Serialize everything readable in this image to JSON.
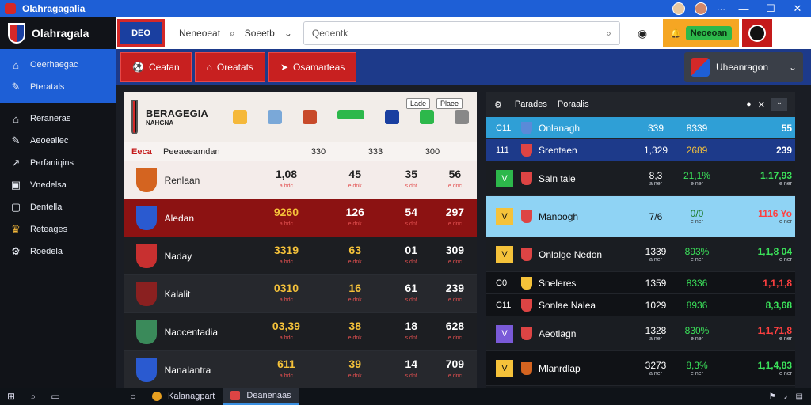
{
  "window": {
    "title": "Olahragagalia",
    "minimize": "—",
    "maximize": "☐",
    "close": "✕"
  },
  "topbar": {
    "brand": "DEO",
    "field_a": "Neneoeat",
    "field_b": "Soeetb",
    "search_placeholder": "Qeoentk",
    "notify_label": "Neoeoan"
  },
  "sidebar": {
    "logo": "Olahragala",
    "top_items": [
      {
        "label": "Oeerhaegac",
        "icon": "home-icon"
      },
      {
        "label": "Pteratals",
        "icon": "tools-icon"
      }
    ],
    "items": [
      {
        "label": "Reraneras",
        "icon": "home-icon"
      },
      {
        "label": "Aeoeallec",
        "icon": "edit-icon"
      },
      {
        "label": "Perfaniqins",
        "icon": "chart-icon"
      },
      {
        "label": "Vnedelsa",
        "icon": "media-icon"
      },
      {
        "label": "Dentella",
        "icon": "calendar-icon"
      },
      {
        "label": "Reteages",
        "icon": "trophy-icon"
      },
      {
        "label": "Roedela",
        "icon": "settings-icon"
      }
    ]
  },
  "subheader": {
    "tabs": [
      {
        "label": "Ceatan",
        "icon": "ball-icon"
      },
      {
        "label": "Oreatats",
        "icon": "home-icon"
      },
      {
        "label": "Osamarteas",
        "icon": "arrow-icon"
      }
    ],
    "league": "Uheanragon"
  },
  "left_panel": {
    "club": "BERAGEGIA",
    "club_sub": "NAHGNA",
    "filter_a": "Lade",
    "filter_b": "Plaee",
    "col_head": {
      "code": "Eeca",
      "name": "Peeaeeamdan",
      "c1": "330",
      "c2": "333",
      "c3": "300"
    },
    "rows": [
      {
        "name": "Renlaan",
        "v1": "1,08",
        "s1": "a hdc",
        "v2": "45",
        "s2": "e dnk",
        "v3": "35",
        "s3": "s dnf",
        "v4": "56",
        "s4": "e dnc"
      },
      {
        "name": "Aledan",
        "v1": "9260",
        "s1": "a hdc",
        "v2": "126",
        "s2": "e dnk",
        "v3": "54",
        "s3": "s dnf",
        "v4": "297",
        "s4": "e dnc"
      },
      {
        "name": "Naday",
        "v1": "3319",
        "s1": "a hdc",
        "v2": "63",
        "s2": "e dnk",
        "v3": "01",
        "s3": "s dnf",
        "v4": "309",
        "s4": "e dnc"
      },
      {
        "name": "Kalalit",
        "v1": "0310",
        "s1": "a hdc",
        "v2": "16",
        "s2": "e dnk",
        "v3": "61",
        "s3": "s dnf",
        "v4": "239",
        "s4": "e dnc"
      },
      {
        "name": "Naocentadia",
        "v1": "03,39",
        "s1": "a hdc",
        "v2": "38",
        "s2": "e dnk",
        "v3": "18",
        "s3": "s dnf",
        "v4": "628",
        "s4": "e dnc"
      },
      {
        "name": "Nanalantra",
        "v1": "611",
        "s1": "a hdc",
        "v2": "39",
        "s2": "e dnk",
        "v3": "14",
        "s3": "s dnf",
        "v4": "709",
        "s4": "e dnc"
      }
    ]
  },
  "right_panel": {
    "head_a": "Parades",
    "head_b": "Poraalis",
    "rows": [
      {
        "pos": "C11",
        "name": "Onlanagh",
        "v1": "339",
        "v2": "8339",
        "v3": "55"
      },
      {
        "pos": "111",
        "name": "Srentaen",
        "v1": "1,329",
        "v2": "2689",
        "v3": "239"
      },
      {
        "pos": "V",
        "name": "Saln tale",
        "v1": "8,3",
        "v1s": "a ner",
        "v2": "21,1%",
        "v2s": "e ner",
        "v3": "1,17,93",
        "v3s": "e ner"
      },
      {
        "pos": "V",
        "name": "Manoogh",
        "v1": "7/6",
        "v2": "0/0",
        "v2s": "e ner",
        "v3": "1116 Yo",
        "v3s": "e ner"
      },
      {
        "pos": "V",
        "name": "Onlalge Nedon",
        "v1": "1339",
        "v1s": "a ner",
        "v2": "893%",
        "v2s": "e ner",
        "v3": "1,1,8 04",
        "v3s": "e ner"
      },
      {
        "pos": "C0",
        "name": "Sneleres",
        "v1": "1359",
        "v2": "8336",
        "v3": "1,1,1,8"
      },
      {
        "pos": "C11",
        "name": "Sonlae Nalea",
        "v1": "1029",
        "v2": "8936",
        "v3": "8,3,68"
      },
      {
        "pos": "V",
        "name": "Aeotlagn",
        "v1": "1328",
        "v1s": "a ner",
        "v2": "830%",
        "v2s": "e ner",
        "v3": "1,1,71,8",
        "v3s": "e ner"
      },
      {
        "pos": "V",
        "name": "Mlanrdlap",
        "v1": "3273",
        "v1s": "a ner",
        "v2": "8,3%",
        "v2s": "e ner",
        "v3": "1,1,4,83",
        "v3s": "e ner"
      }
    ]
  },
  "taskbar": {
    "app_a": "Kalanagpart",
    "app_b": "Deanenaas"
  }
}
